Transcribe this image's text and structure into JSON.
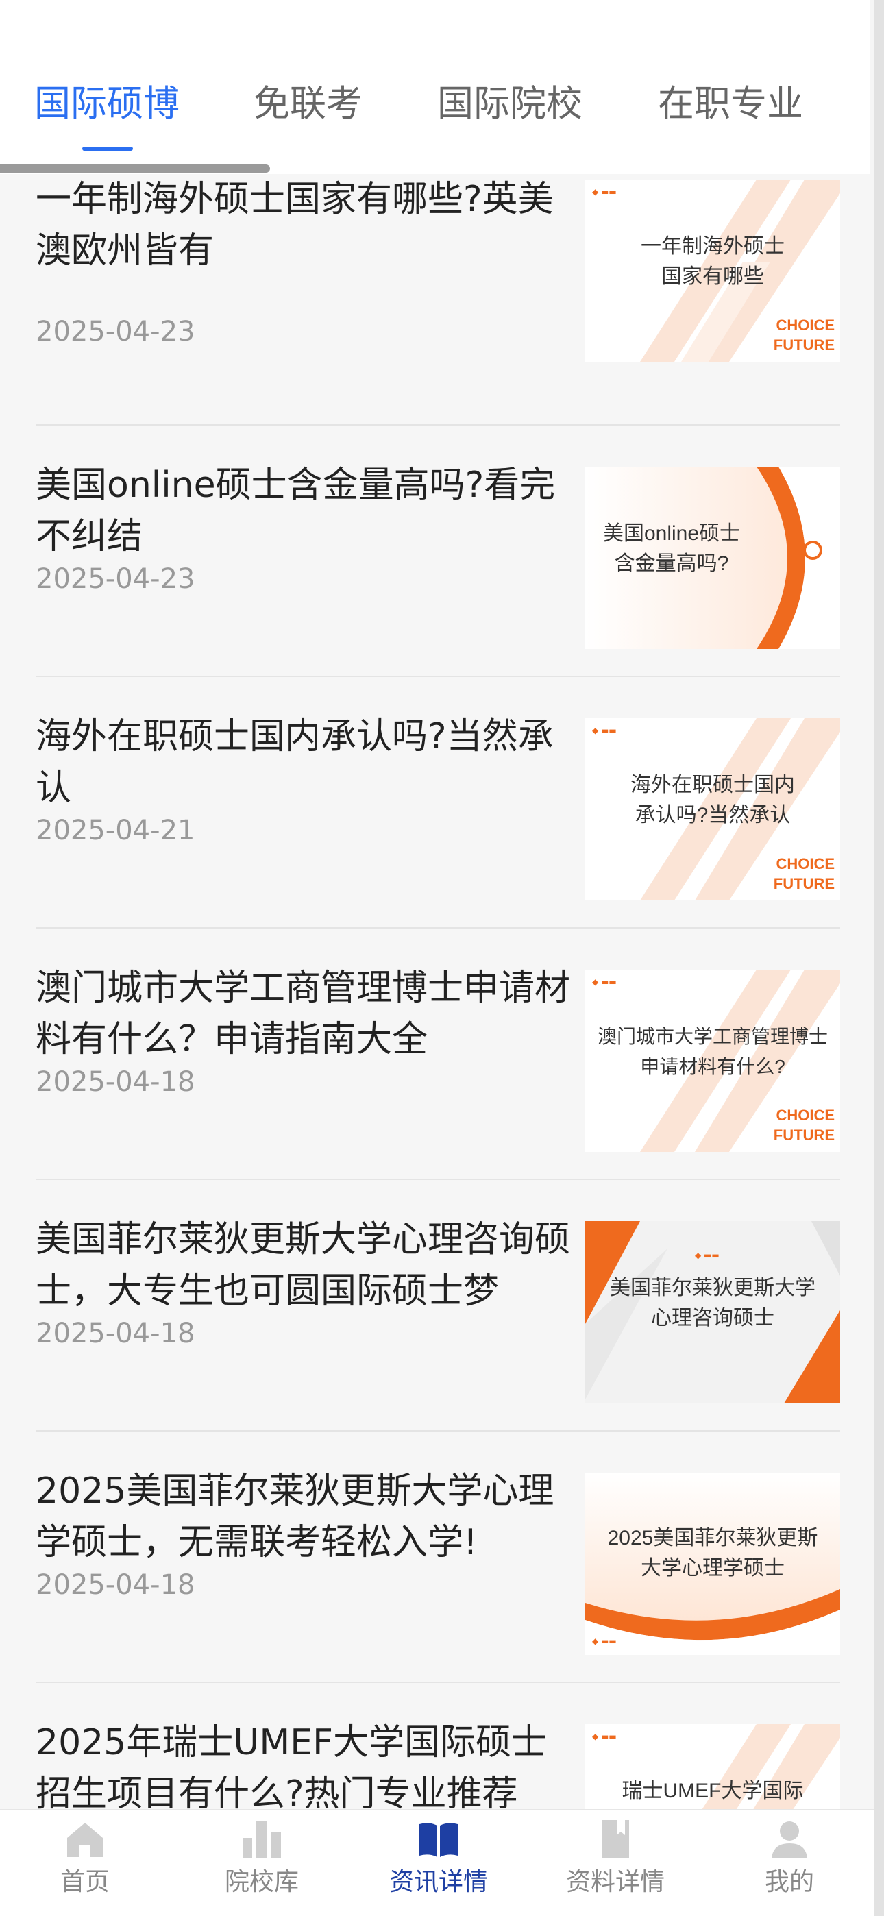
{
  "tabs": [
    {
      "label": "国际硕博",
      "active": true
    },
    {
      "label": "免联考",
      "active": false
    },
    {
      "label": "国际院校",
      "active": false
    },
    {
      "label": "在职专业",
      "active": false
    }
  ],
  "articles": [
    {
      "title": "一年制海外硕士国家有哪些?英美澳欧州皆有",
      "date": "2025-04-23",
      "thumb_text": "一年制海外硕士\n国家有哪些",
      "thumb_brand": "CHOICE\nFUTURE",
      "style": "stripes"
    },
    {
      "title": "美国online硕士含金量高吗?看完不纠结",
      "date": "2025-04-23",
      "thumb_text": "美国online硕士\n含金量高吗?",
      "thumb_brand": "",
      "style": "arc"
    },
    {
      "title": "海外在职硕士国内承认吗?当然承认",
      "date": "2025-04-21",
      "thumb_text": "海外在职硕士国内\n承认吗?当然承认",
      "thumb_brand": "CHOICE\nFUTURE",
      "style": "stripes"
    },
    {
      "title": "澳门城市大学工商管理博士申请材料有什么？申请指南大全",
      "date": "2025-04-18",
      "thumb_text": "澳门城市大学工商管理博士\n申请材料有什么?",
      "thumb_brand": "CHOICE\nFUTURE",
      "style": "stripes"
    },
    {
      "title": "美国菲尔莱狄更斯大学心理咨询硕士，大专生也可圆国际硕士梦",
      "date": "2025-04-18",
      "thumb_text": "美国菲尔莱狄更斯大学\n心理咨询硕士",
      "thumb_brand": "",
      "style": "triangles"
    },
    {
      "title": "2025美国菲尔莱狄更斯大学心理学硕士，无需联考轻松入学!",
      "date": "2025-04-18",
      "thumb_text": "2025美国菲尔莱狄更斯\n大学心理学硕士",
      "thumb_brand": "",
      "style": "wave"
    },
    {
      "title": "2025年瑞士UMEF大学国际硕士招生项目有什么?热门专业推荐",
      "date": "",
      "thumb_text": "瑞士UMEF大学国际\n硕士招生项目有什么",
      "thumb_brand": "",
      "style": "stripes"
    }
  ],
  "tabbar": [
    {
      "label": "首页",
      "icon": "home-icon",
      "active": false
    },
    {
      "label": "院校库",
      "icon": "bar-chart-icon",
      "active": false
    },
    {
      "label": "资讯详情",
      "icon": "open-book-icon",
      "active": true
    },
    {
      "label": "资料详情",
      "icon": "book-icon",
      "active": false
    },
    {
      "label": "我的",
      "icon": "user-icon",
      "active": false
    }
  ],
  "colors": {
    "accent": "#2b6ff1",
    "tabbar_active": "#1e3fa3",
    "thumb_orange": "#ef6a1e"
  }
}
